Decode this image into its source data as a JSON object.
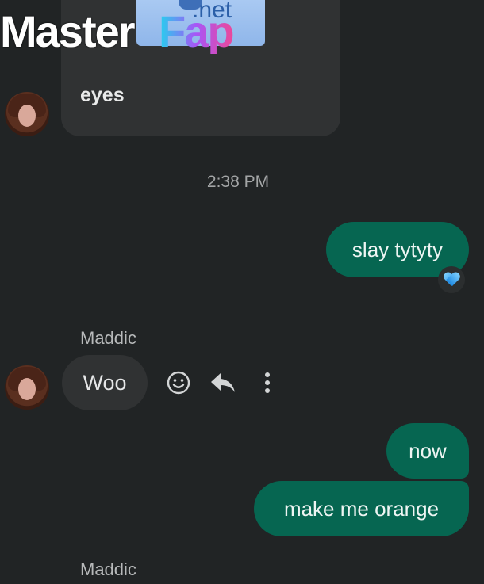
{
  "watermark": {
    "part1": "Master",
    "part2": "Fap",
    "part3": ".net"
  },
  "messages": {
    "incoming_card_text": "eyes",
    "timestamp": "2:38 PM",
    "outgoing_1": "slay tytyty",
    "sender_1": "Maddic",
    "incoming_1": "Woo",
    "outgoing_2": "now",
    "outgoing_3": "make me orange",
    "sender_2": "Maddic"
  },
  "reaction": {
    "icon": "blue-heart-icon",
    "color": "#3aa6f0"
  },
  "actions": {
    "icons": [
      "emoji-icon",
      "reply-icon",
      "more-options-icon"
    ]
  },
  "colors": {
    "background": "#212425",
    "outgoing_bubble": "#066651",
    "incoming_bubble": "#303233",
    "text_secondary": "#a3a5a6"
  }
}
